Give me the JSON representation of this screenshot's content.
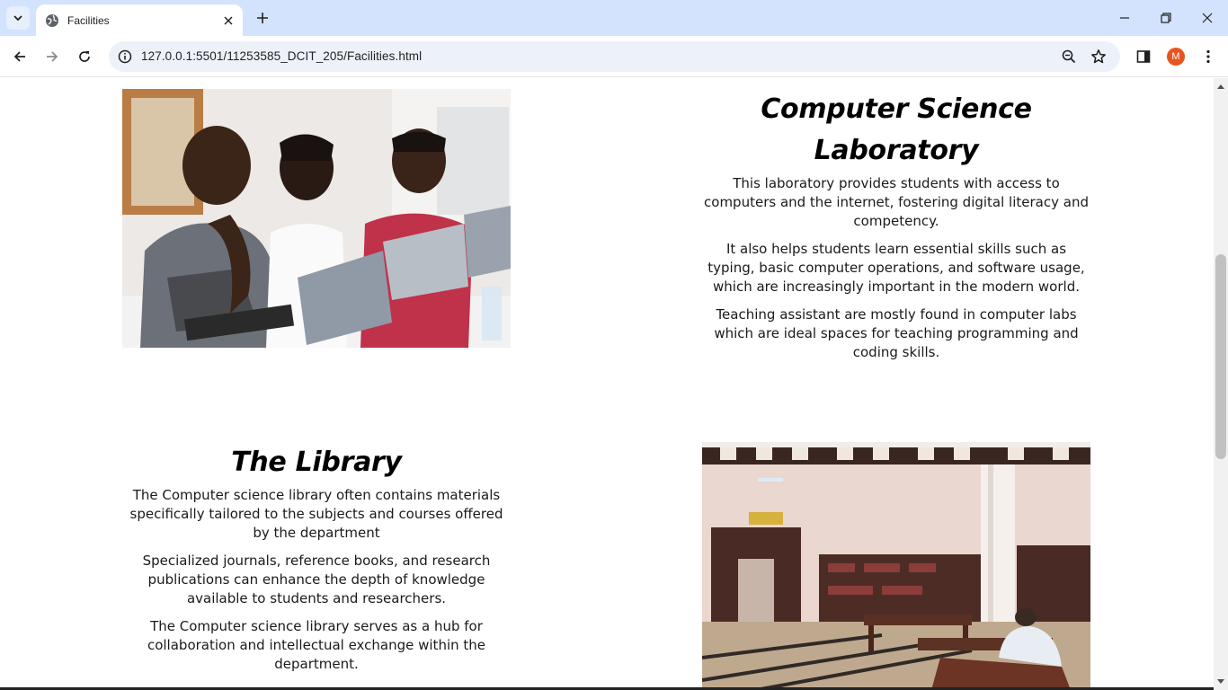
{
  "browser": {
    "tab_title": "Facilities",
    "url": "127.0.0.1:5501/11253585_DCIT_205/Facilities.html",
    "profile_initial": "M",
    "accent": "#d3e3fd"
  },
  "page": {
    "lab": {
      "title": "Computer Science Laboratory",
      "paragraphs": [
        "This laboratory provides students with access to computers and the internet, fostering digital literacy and competency.",
        "It also helps students learn essential skills such as typing, basic computer operations, and software usage, which are increasingly important in the modern world.",
        "Teaching assistant are mostly found in computer labs which are ideal spaces for teaching programming and coding skills."
      ]
    },
    "library": {
      "title": "The Library",
      "paragraphs": [
        "The Computer science library often contains materials specifically tailored to the subjects and courses offered by the department",
        "Specialized journals, reference books, and research publications can enhance the depth of knowledge available to students and researchers.",
        "The Computer science library serves as a hub for collaboration and intellectual exchange within the department."
      ]
    }
  }
}
